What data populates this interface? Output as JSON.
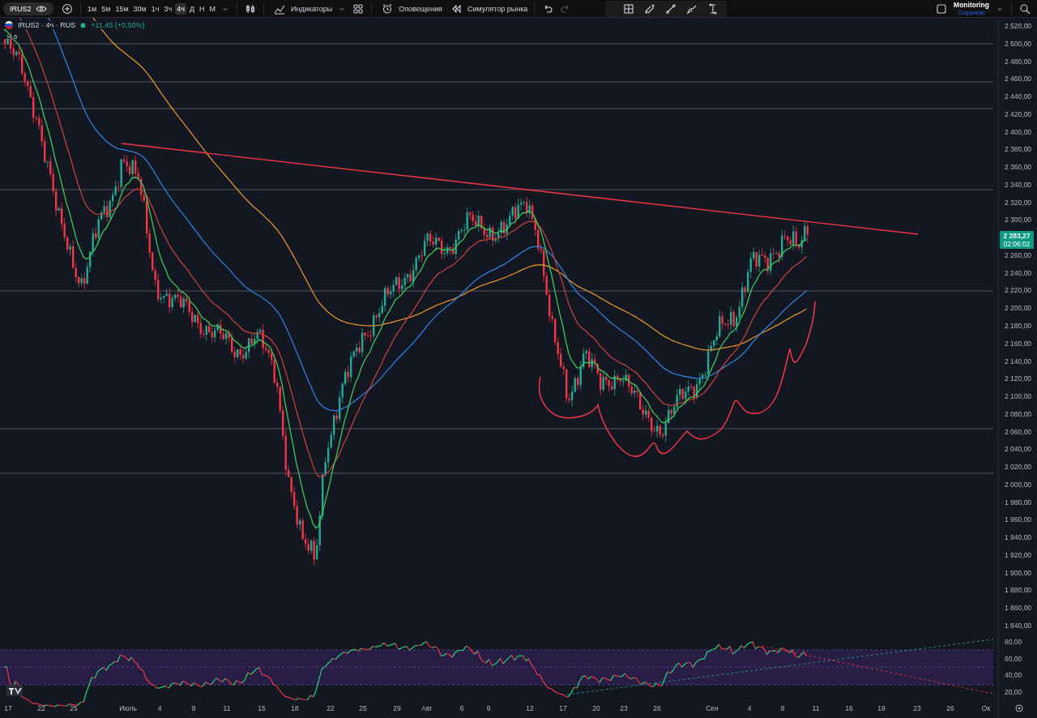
{
  "toolbar": {
    "symbol": "IRUS2",
    "intervals": [
      {
        "label": "1м",
        "selected": false
      },
      {
        "label": "5м",
        "selected": false
      },
      {
        "label": "15м",
        "selected": false
      },
      {
        "label": "30м",
        "selected": false
      },
      {
        "label": "1ч",
        "selected": false
      },
      {
        "label": "3ч",
        "selected": false
      },
      {
        "label": "4ч",
        "selected": true
      },
      {
        "label": "Д",
        "selected": false
      },
      {
        "label": "Н",
        "selected": false
      },
      {
        "label": "М",
        "selected": false
      }
    ],
    "indicators": "Индикаторы",
    "alerts": "Оповещения",
    "replay": "Симулятор рынка",
    "layout_name": "Monitoring",
    "layout_status": "Сохранено"
  },
  "legend": {
    "title": "IRUS2 · 4ч · RUS",
    "change": "+11,45 (+0,50%)",
    "indicator_count": "6"
  },
  "price_axis": {
    "labels": [
      "2 520,00",
      "2 500,00",
      "2 480,00",
      "2 460,00",
      "2 440,00",
      "2 420,00",
      "2 400,00",
      "2 380,00",
      "2 360,00",
      "2 340,00",
      "2 320,00",
      "2 300,00",
      "2 260,00",
      "2 240,00",
      "2 220,00",
      "2 200,00",
      "2 180,00",
      "2 160,00",
      "2 140,00",
      "2 120,00",
      "2 100,00",
      "2 080,00",
      "2 060,00",
      "2 040,00",
      "2 020,00",
      "2 000,00",
      "1 980,00",
      "1 960,00",
      "1 940,00",
      "1 920,00",
      "1 900,00",
      "1 880,00",
      "1 860,00",
      "1 840,00"
    ]
  },
  "current_price": {
    "price": "2 283,27",
    "countdown": "02:06:02"
  },
  "rsi_axis": {
    "labels": [
      "80,00",
      "60,00",
      "40,00",
      "20,00"
    ]
  },
  "time_axis": {
    "labels": [
      "17",
      "22",
      "25",
      "Июль",
      "4",
      "8",
      "11",
      "15",
      "18",
      "22",
      "25",
      "29",
      "Авг",
      "6",
      "9",
      "12",
      "17",
      "20",
      "23",
      "26",
      "Сен",
      "4",
      "8",
      "11",
      "16",
      "19",
      "23",
      "26",
      "Ок"
    ]
  }
}
